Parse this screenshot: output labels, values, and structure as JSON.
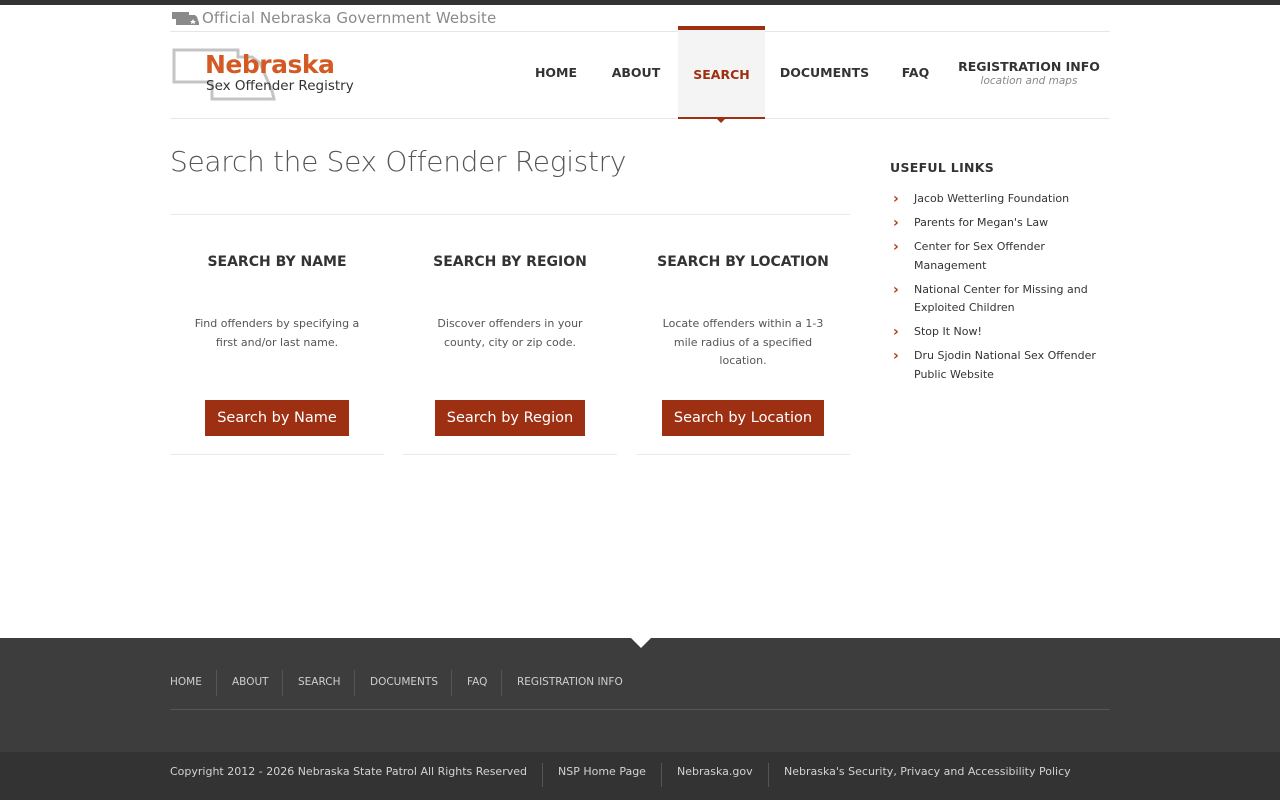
{
  "header": {
    "official_text": "Official Nebraska Government Website",
    "logo_title": "Nebraska",
    "logo_subtitle": "Sex Offender Registry"
  },
  "nav": {
    "items": [
      {
        "label": "HOME"
      },
      {
        "label": "ABOUT"
      },
      {
        "label": "SEARCH",
        "active": true
      },
      {
        "label": "DOCUMENTS"
      },
      {
        "label": "FAQ"
      },
      {
        "label": "REGISTRATION INFO",
        "sublabel": "location and maps"
      }
    ]
  },
  "main": {
    "title": "Search the Sex Offender Registry",
    "columns": [
      {
        "heading": "SEARCH BY NAME",
        "description": "Find offenders by specifying a first and/or last name.",
        "button": "Search by Name"
      },
      {
        "heading": "SEARCH BY REGION",
        "description": "Discover offenders in your county, city or zip code.",
        "button": "Search by Region"
      },
      {
        "heading": "SEARCH BY LOCATION",
        "description": "Locate offenders within a 1-3 mile radius of a specified location.",
        "button": "Search by Location"
      }
    ]
  },
  "sidebar": {
    "title": "USEFUL LINKS",
    "links": [
      "Jacob Wetterling Foundation",
      "Parents for Megan's Law",
      "Center for Sex Offender Management",
      "National Center for Missing and Exploited Children",
      "Stop It Now!",
      "Dru Sjodin National Sex Offender Public Website"
    ]
  },
  "footer": {
    "nav": [
      "HOME",
      "ABOUT",
      "SEARCH",
      "DOCUMENTS",
      "FAQ",
      "REGISTRATION INFO"
    ],
    "copyright": "Copyright 2012 - 2026 Nebraska State Patrol All Rights Reserved",
    "links": [
      "NSP Home Page",
      "Nebraska.gov",
      "Nebraska's Security, Privacy and Accessibility Policy"
    ]
  },
  "colors": {
    "accent": "#9d2f12",
    "logo_orange": "#d35a22",
    "footer_bg": "#3d3d3d",
    "bottom_bg": "#333333"
  },
  "icons": {
    "state_icon": "nebraska-state-icon",
    "link_bullet": "chevron-right-icon"
  }
}
